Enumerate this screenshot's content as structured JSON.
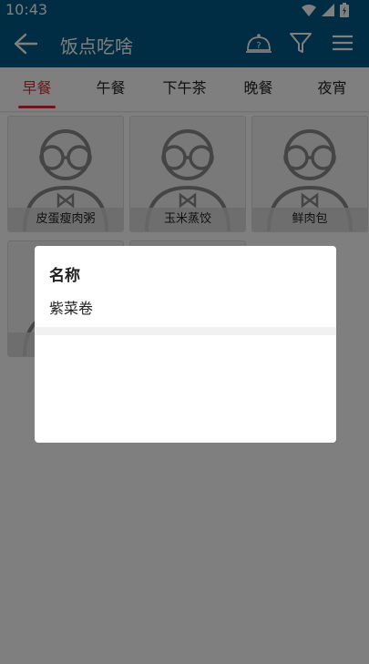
{
  "status_bar": {
    "time": "10:43",
    "icons": [
      "wifi-icon",
      "signal-icon",
      "battery-icon"
    ]
  },
  "app_bar": {
    "title": "饭点吃啥",
    "icons": [
      "back-arrow-icon",
      "food-tray-question-icon",
      "filter-icon",
      "menu-icon"
    ]
  },
  "tabs": [
    {
      "label": "早餐",
      "active": true
    },
    {
      "label": "午餐",
      "active": false
    },
    {
      "label": "下午茶",
      "active": false
    },
    {
      "label": "晚餐",
      "active": false
    },
    {
      "label": "夜宵",
      "active": false
    }
  ],
  "items": [
    {
      "name": "皮蛋瘦肉粥"
    },
    {
      "name": "玉米蒸饺"
    },
    {
      "name": "鲜肉包"
    },
    {
      "name": ""
    },
    {
      "name": ""
    }
  ],
  "dialog": {
    "title": "名称",
    "value": "紫菜卷"
  },
  "colors": {
    "primary": "#005a87",
    "accent": "#d22f3a",
    "overlay": "rgba(0,0,0,0.5)"
  }
}
